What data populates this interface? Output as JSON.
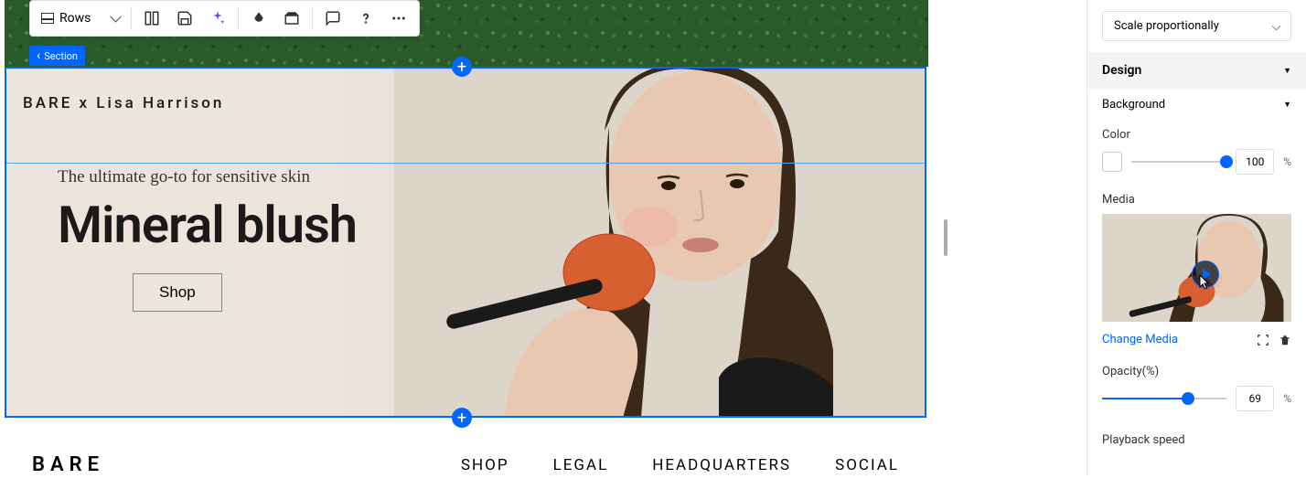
{
  "toolbar": {
    "rows_label": "Rows"
  },
  "section_tag": "Section",
  "hero": {
    "brand_collab": "BARE x Lisa Harrison",
    "subtitle": "The ultimate go-to for sensitive skin",
    "title": "Mineral blush",
    "shop_label": "Shop"
  },
  "footer": {
    "logo": "BARE",
    "nav": [
      "SHOP",
      "LEGAL",
      "HEADQUARTERS",
      "SOCIAL"
    ]
  },
  "panel": {
    "scale_mode": "Scale proportionally",
    "design_header": "Design",
    "background_header": "Background",
    "color_label": "Color",
    "color_value": "100",
    "color_unit": "%",
    "media_label": "Media",
    "change_media": "Change Media",
    "opacity_label": "Opacity(%)",
    "opacity_value": "69",
    "opacity_unit": "%",
    "playback_label": "Playback speed"
  }
}
